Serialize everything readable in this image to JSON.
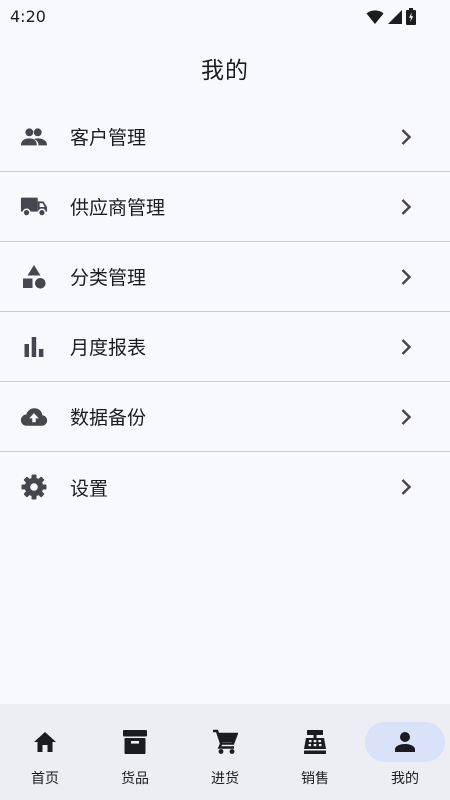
{
  "status_bar": {
    "time": "4:20",
    "icons": [
      "wifi-icon",
      "signal-icon",
      "battery-icon"
    ]
  },
  "app_bar": {
    "title": "我的"
  },
  "menu": {
    "items": [
      {
        "label": "客户管理",
        "icon": "people-icon"
      },
      {
        "label": "供应商管理",
        "icon": "truck-icon"
      },
      {
        "label": "分类管理",
        "icon": "category-icon"
      },
      {
        "label": "月度报表",
        "icon": "bar-chart-icon"
      },
      {
        "label": "数据备份",
        "icon": "cloud-upload-icon"
      },
      {
        "label": "设置",
        "icon": "gear-icon"
      }
    ]
  },
  "bottom_nav": {
    "active_index": 4,
    "items": [
      {
        "label": "首页",
        "icon": "home-icon"
      },
      {
        "label": "货品",
        "icon": "archive-box-icon"
      },
      {
        "label": "进货",
        "icon": "cart-icon"
      },
      {
        "label": "销售",
        "icon": "cash-register-icon"
      },
      {
        "label": "我的",
        "icon": "person-icon"
      }
    ]
  },
  "colors": {
    "background": "#f8f9ff",
    "divider": "#c9cbd3",
    "icon": "#44474f",
    "nav_background": "#eceef4",
    "nav_active_indicator": "#d9e2f8"
  }
}
